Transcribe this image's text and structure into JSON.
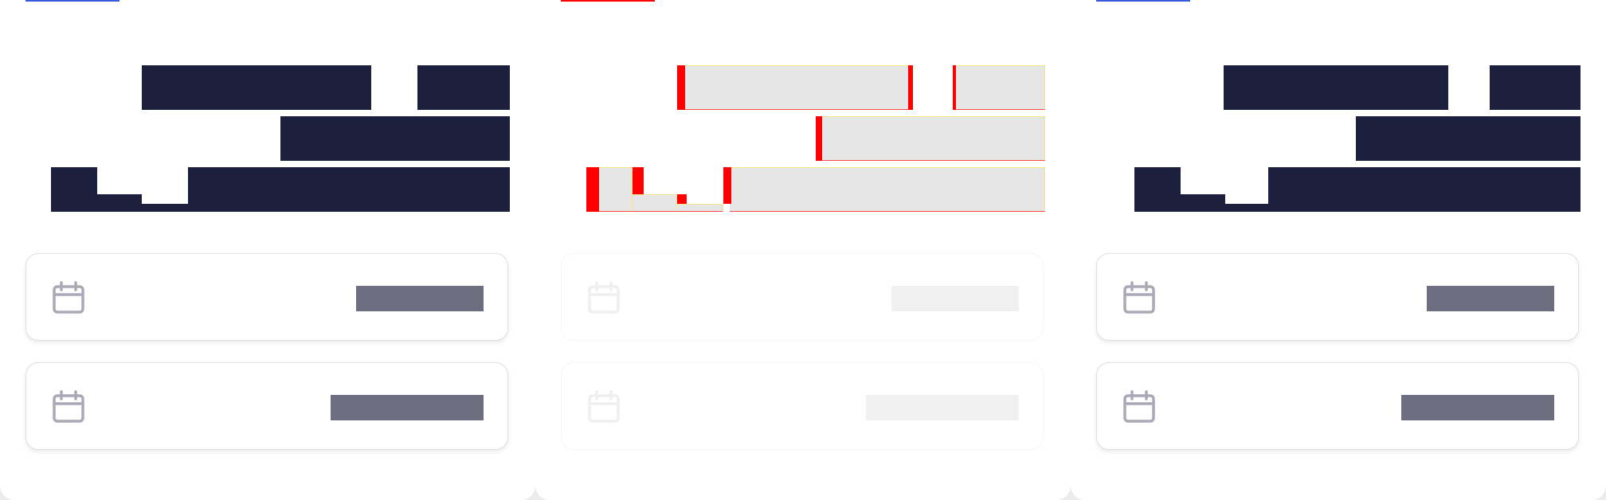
{
  "panels": [
    {
      "id": "panel-1",
      "variant": "baseline",
      "tab_indicator_color": "#3a5bd9",
      "headline_style": "redacted-dark",
      "cards": [
        {
          "icon": "calendar-icon",
          "value": ""
        },
        {
          "icon": "calendar-icon",
          "value": ""
        }
      ]
    },
    {
      "id": "panel-2",
      "variant": "diff",
      "tab_indicator_color": "#ff0000",
      "headline_style": "diff-highlight",
      "cards": [
        {
          "icon": "calendar-icon",
          "value": ""
        },
        {
          "icon": "calendar-icon",
          "value": ""
        }
      ]
    },
    {
      "id": "panel-3",
      "variant": "comparison",
      "tab_indicator_color": "#3a5bd9",
      "headline_style": "redacted-dark",
      "cards": [
        {
          "icon": "calendar-icon",
          "value": ""
        },
        {
          "icon": "calendar-icon",
          "value": ""
        }
      ]
    }
  ],
  "colors": {
    "redaction_dark": "#1c1f3c",
    "chip_gray": "#6c6d7e",
    "diff_fill": "#e6e6e6",
    "diff_marker": "#ff0000",
    "accent_blue": "#3a5bd9"
  }
}
